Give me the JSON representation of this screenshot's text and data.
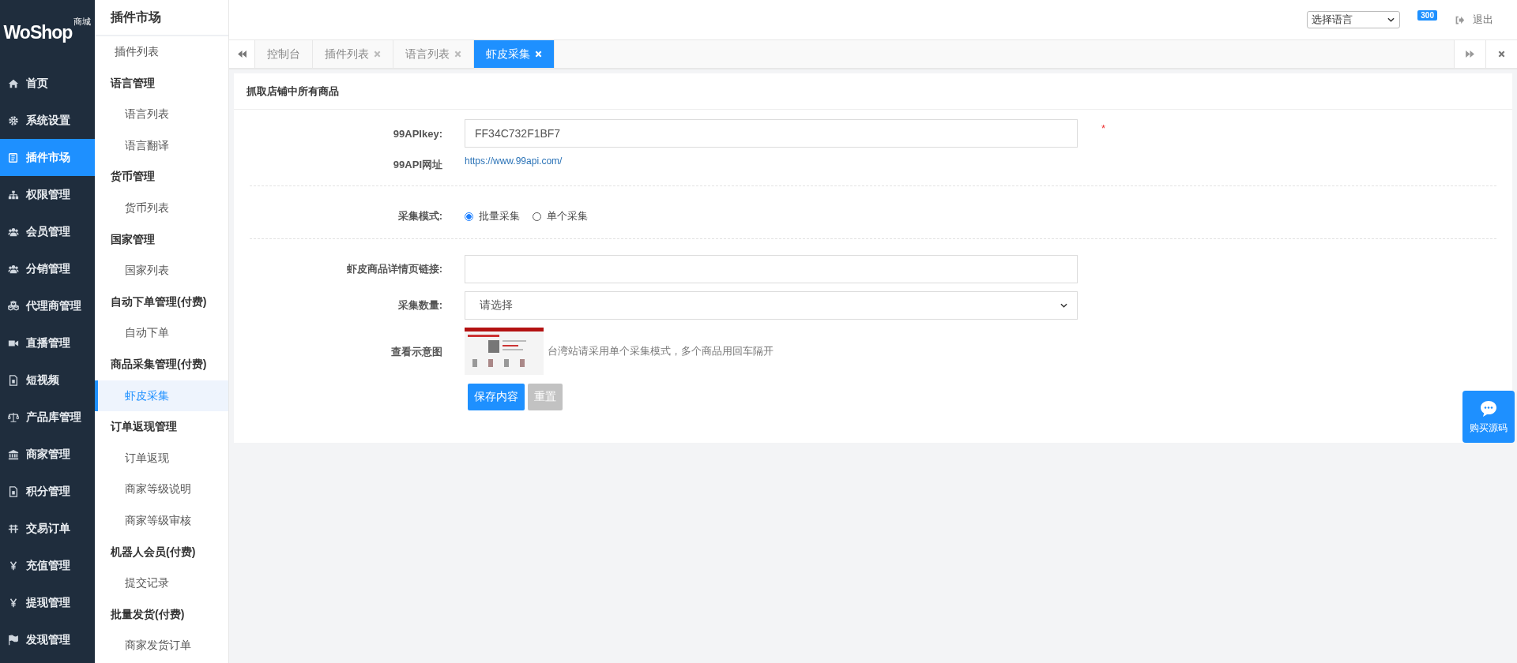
{
  "logo": {
    "text": "WoShop",
    "badge": "商城"
  },
  "nav": [
    {
      "label": "首页",
      "selected": false
    },
    {
      "label": "系统设置",
      "selected": false
    },
    {
      "label": "插件市场",
      "selected": true
    },
    {
      "label": "权限管理",
      "selected": false
    },
    {
      "label": "会员管理",
      "selected": false
    },
    {
      "label": "分销管理",
      "selected": false
    },
    {
      "label": "代理商管理",
      "selected": false
    },
    {
      "label": "直播管理",
      "selected": false
    },
    {
      "label": "短视频",
      "selected": false
    },
    {
      "label": "产品库管理",
      "selected": false
    },
    {
      "label": "商家管理",
      "selected": false
    },
    {
      "label": "积分管理",
      "selected": false
    },
    {
      "label": "交易订单",
      "selected": false
    },
    {
      "label": "充值管理",
      "selected": false
    },
    {
      "label": "提现管理",
      "selected": false
    },
    {
      "label": "发现管理",
      "selected": false
    }
  ],
  "submenu": {
    "title": "插件市场",
    "items": [
      {
        "kind": "item",
        "label": "插件列表",
        "selected": false
      },
      {
        "kind": "group",
        "label": "语言管理"
      },
      {
        "kind": "item",
        "label": "语言列表",
        "selected": false
      },
      {
        "kind": "item",
        "label": "语言翻译",
        "selected": false
      },
      {
        "kind": "group",
        "label": "货币管理"
      },
      {
        "kind": "item",
        "label": "货币列表",
        "selected": false
      },
      {
        "kind": "group",
        "label": "国家管理"
      },
      {
        "kind": "item",
        "label": "国家列表",
        "selected": false
      },
      {
        "kind": "group",
        "label": "自动下单管理(付费)"
      },
      {
        "kind": "item",
        "label": "自动下单",
        "selected": false
      },
      {
        "kind": "group",
        "label": "商品采集管理(付费)"
      },
      {
        "kind": "item",
        "label": "虾皮采集",
        "selected": true
      },
      {
        "kind": "group",
        "label": "订单返现管理"
      },
      {
        "kind": "item",
        "label": "订单返现",
        "selected": false
      },
      {
        "kind": "item",
        "label": "商家等级说明",
        "selected": false
      },
      {
        "kind": "item",
        "label": "商家等级审核",
        "selected": false
      },
      {
        "kind": "group",
        "label": "机器人会员(付费)"
      },
      {
        "kind": "item",
        "label": "提交记录",
        "selected": false
      },
      {
        "kind": "group",
        "label": "批量发货(付费)"
      },
      {
        "kind": "item",
        "label": "商家发货订单",
        "selected": false
      }
    ]
  },
  "header": {
    "language_select": {
      "value": "选择语言"
    },
    "notification_count": "300",
    "logout": "退出"
  },
  "tabs": [
    {
      "label": "控制台",
      "closable": false,
      "selected": false
    },
    {
      "label": "插件列表",
      "closable": true,
      "selected": false
    },
    {
      "label": "语言列表",
      "closable": true,
      "selected": false
    },
    {
      "label": "虾皮采集",
      "closable": true,
      "selected": true
    }
  ],
  "panel": {
    "title": "抓取店铺中所有商品",
    "api_key": {
      "label": "99APIkey:",
      "value": "FF34C732F1BF7",
      "required_mark": "*"
    },
    "api_url": {
      "label": "99API网址",
      "link": "https://www.99api.com/"
    },
    "mode": {
      "label": "采集模式:",
      "options": [
        {
          "label": "批量采集",
          "selected": true
        },
        {
          "label": "单个采集",
          "selected": false
        }
      ]
    },
    "detail_link": {
      "label": "虾皮商品详情页链接:"
    },
    "quantity": {
      "label": "采集数量:",
      "value": "请选择"
    },
    "example": {
      "label": "查看示意图",
      "hint": "台湾站请采用单个采集模式，多个商品用回车隔开"
    },
    "buttons": [
      {
        "kind": "primary",
        "label": "保存内容"
      },
      {
        "kind": "secondary",
        "label": "重置"
      }
    ]
  },
  "float_button": {
    "label": "购买源码"
  }
}
